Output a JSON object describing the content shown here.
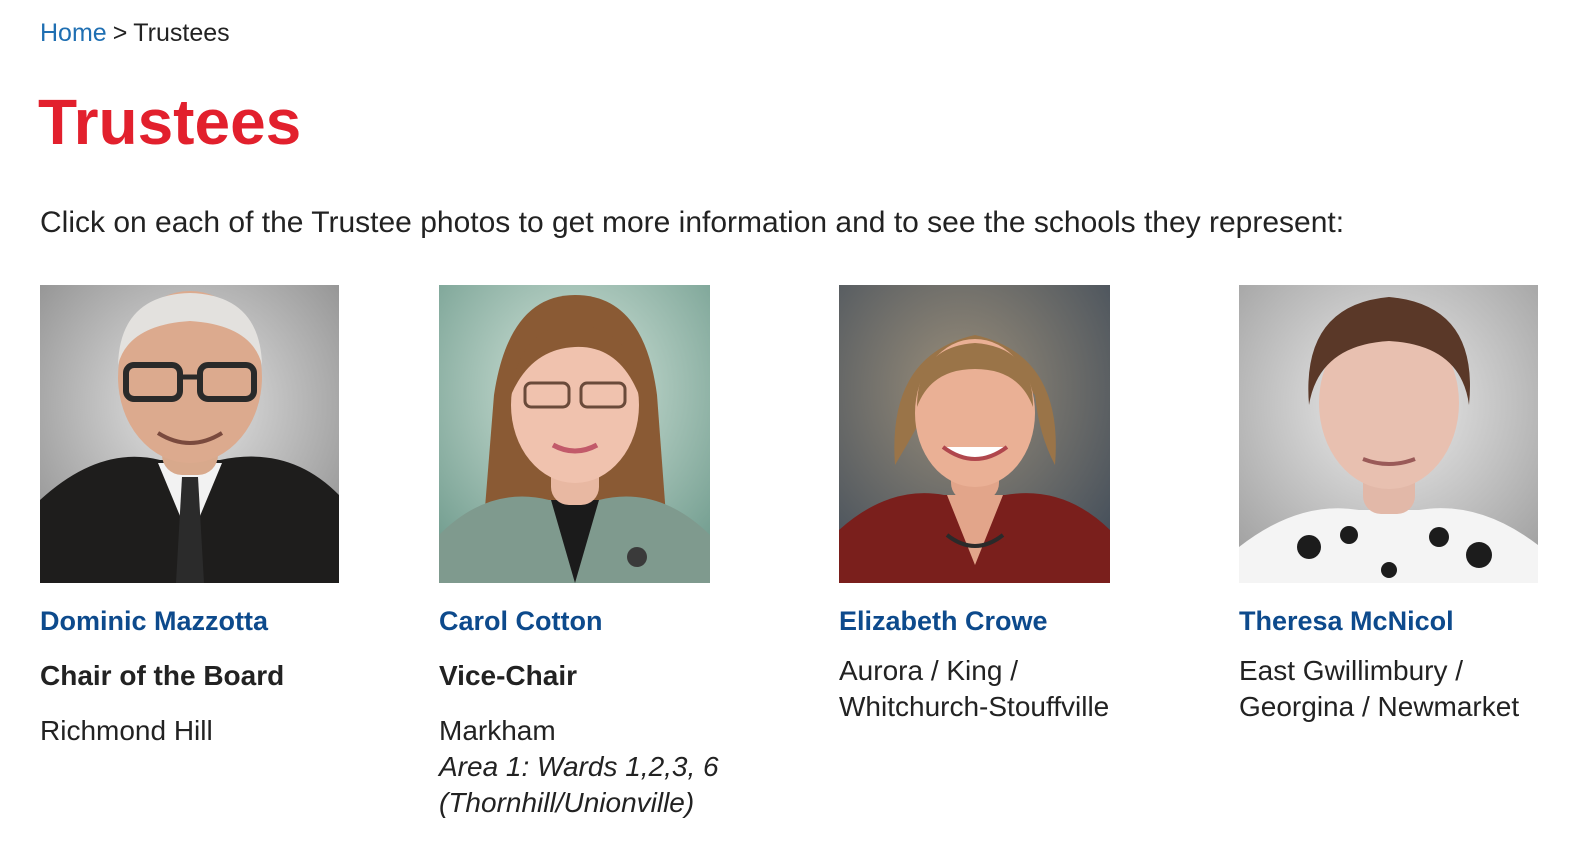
{
  "breadcrumb": {
    "home": "Home",
    "separator": ">",
    "current": "Trustees"
  },
  "page": {
    "title": "Trustees",
    "intro": "Click on each of the Trustee photos to get more information and to see the schools they represent:"
  },
  "colors": {
    "title": "#e2202d",
    "link": "#1f6fb2",
    "name": "#0d4a8c",
    "text": "#222222"
  },
  "trustees": [
    {
      "name": "Dominic Mazzotta",
      "role": "Chair of the Board",
      "area_lines": [
        "Richmond Hill"
      ],
      "note_lines": []
    },
    {
      "name": "Carol Cotton",
      "role": "Vice-Chair",
      "area_lines": [
        "Markham"
      ],
      "note_lines": [
        "Area 1: Wards 1,2,3, 6",
        "(Thornhill/Unionville)"
      ]
    },
    {
      "name": "Elizabeth Crowe",
      "role": "",
      "area_lines": [
        "Aurora / King /",
        "Whitchurch-Stouffville"
      ],
      "note_lines": []
    },
    {
      "name": "Theresa McNicol",
      "role": "",
      "area_lines": [
        "East Gwillimbury /",
        "Georgina / Newmarket"
      ],
      "note_lines": []
    }
  ]
}
